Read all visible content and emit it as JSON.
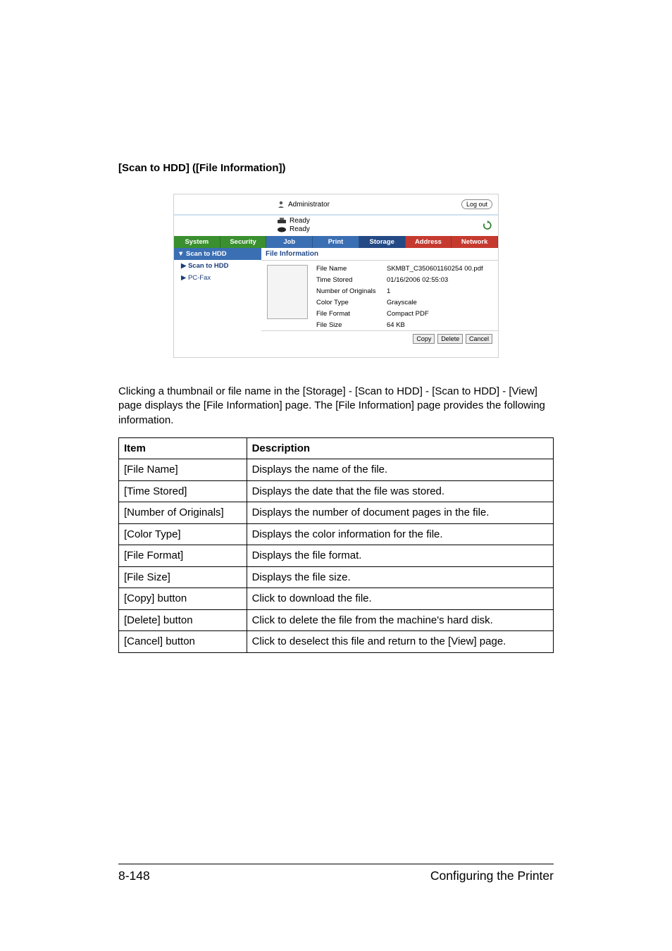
{
  "section_title": "[Scan to HDD] ([File Information])",
  "screenshot": {
    "admin_label": "Administrator",
    "logout_label": "Log out",
    "status1": "Ready",
    "status2": "Ready",
    "tabs": {
      "system": "System",
      "security": "Security",
      "job": "Job",
      "print": "Print",
      "storage": "Storage",
      "address": "Address",
      "network": "Network"
    },
    "sidebar": {
      "header": "▼ Scan to HDD",
      "item1": "▶ Scan to HDD",
      "item2": "▶ PC-Fax"
    },
    "main_header": "File Information",
    "fields": {
      "file_name_label": "File Name",
      "file_name_value": "SKMBT_C350601160254 00.pdf",
      "time_stored_label": "Time Stored",
      "time_stored_value": "01/16/2006 02:55:03",
      "num_orig_label": "Number of Originals",
      "num_orig_value": "1",
      "color_type_label": "Color Type",
      "color_type_value": "Grayscale",
      "file_format_label": "File Format",
      "file_format_value": "Compact PDF",
      "file_size_label": "File Size",
      "file_size_value": "64 KB"
    },
    "buttons": {
      "copy": "Copy",
      "delete": "Delete",
      "cancel": "Cancel"
    }
  },
  "paragraph": "Clicking a thumbnail or file name in the [Storage] - [Scan to HDD] - [Scan to HDD] - [View] page displays the [File Information] page. The [File Information] page provides the following information.",
  "table": {
    "head_item": "Item",
    "head_desc": "Description",
    "rows": [
      {
        "item": "[File Name]",
        "desc": "Displays the name of the file."
      },
      {
        "item": "[Time Stored]",
        "desc": "Displays the date that the file was stored."
      },
      {
        "item": "[Number of Originals]",
        "desc": "Displays the number of document pages in the file."
      },
      {
        "item": "[Color Type]",
        "desc": "Displays the color information for the file."
      },
      {
        "item": "[File Format]",
        "desc": "Displays the file format."
      },
      {
        "item": "[File Size]",
        "desc": "Displays the file size."
      },
      {
        "item": "[Copy] button",
        "desc": "Click to download the file."
      },
      {
        "item": "[Delete] button",
        "desc": "Click to delete the file from the machine's hard disk."
      },
      {
        "item": "[Cancel] button",
        "desc": "Click to deselect this file and return to the [View] page."
      }
    ]
  },
  "footer": {
    "page_number": "8-148",
    "section": "Configuring the Printer"
  }
}
